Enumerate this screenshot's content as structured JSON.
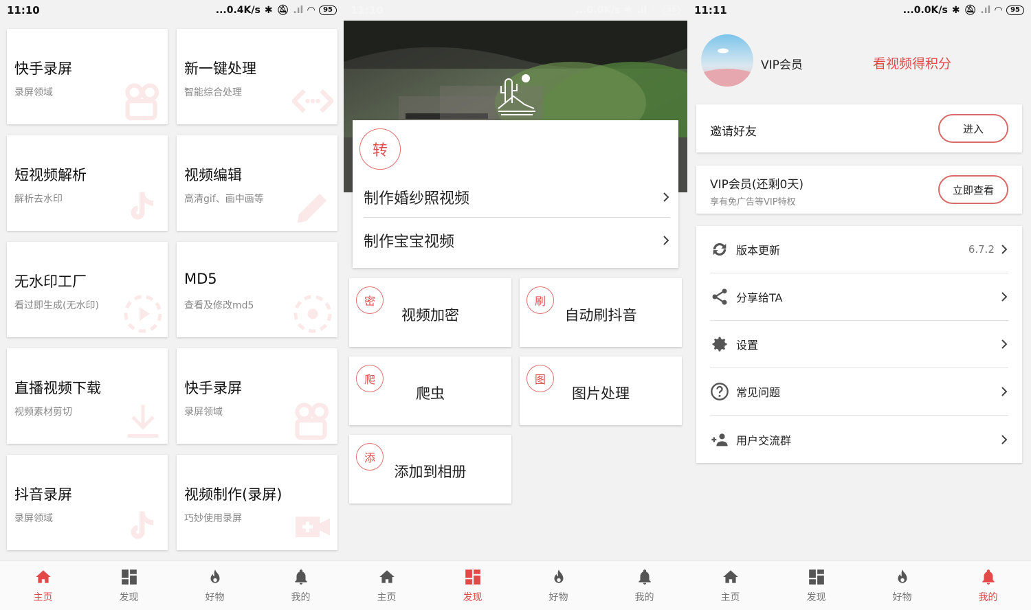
{
  "colors": {
    "accent": "#e24a4a",
    "badge_border": "#e07070"
  },
  "screen1": {
    "status": {
      "time": "11:10",
      "speed": "...0.4K/s",
      "battery": "95"
    },
    "cards": [
      {
        "title": "快手录屏",
        "sub": "录屏领域",
        "icon": "video-camera-icon"
      },
      {
        "title": "新一键处理",
        "sub": "智能综合处理",
        "icon": "code-arrows-icon"
      },
      {
        "title": "短视频解析",
        "sub": "解析去水印",
        "icon": "tiktok-note-icon"
      },
      {
        "title": "视频编辑",
        "sub": "高清gif、画中画等",
        "icon": "pencil-icon"
      },
      {
        "title": "无水印工厂",
        "sub": "看过即生成(无水印)",
        "icon": "play-circle-icon"
      },
      {
        "title": "MD5",
        "sub": "查看及修改md5",
        "icon": "target-icon"
      },
      {
        "title": "直播视频下载",
        "sub": "视频素材剪切",
        "icon": "download-icon"
      },
      {
        "title": "快手录屏",
        "sub": "录屏领域",
        "icon": "video-camera-icon"
      },
      {
        "title": "抖音录屏",
        "sub": "录屏领域",
        "icon": "tiktok-note-icon"
      },
      {
        "title": "视频制作(录屏)",
        "sub": "巧妙使用录屏",
        "icon": "add-video-icon"
      }
    ]
  },
  "screen2": {
    "status": {
      "time": "11:10",
      "speed": "...0.0K/s",
      "battery": "95"
    },
    "feature": {
      "badge": "转",
      "rows": [
        "制作婚纱照视频",
        "制作宝宝视频"
      ]
    },
    "tiles": [
      {
        "badge": "密",
        "label": "视频加密"
      },
      {
        "badge": "刷",
        "label": "自动刷抖音"
      },
      {
        "badge": "爬",
        "label": "爬虫"
      },
      {
        "badge": "图",
        "label": "图片处理"
      },
      {
        "badge": "添",
        "label": "添加到相册"
      }
    ]
  },
  "screen3": {
    "status": {
      "time": "11:11",
      "speed": "...0.0K/s",
      "battery": "95"
    },
    "profile": {
      "name": "VIP会员",
      "points_link": "看视频得积分"
    },
    "invite": {
      "label": "邀请好友",
      "button": "进入"
    },
    "vip": {
      "title": "VIP会员(还剩0天)",
      "sub": "享有免广告等VIP特权",
      "button": "立即查看"
    },
    "menu": [
      {
        "label": "版本更新",
        "value": "6.7.2",
        "icon": "refresh-icon"
      },
      {
        "label": "分享给TA",
        "value": "",
        "icon": "share-icon"
      },
      {
        "label": "设置",
        "value": "",
        "icon": "gear-icon"
      },
      {
        "label": "常见问题",
        "value": "",
        "icon": "question-icon"
      },
      {
        "label": "用户交流群",
        "value": "",
        "icon": "group-icon"
      }
    ]
  },
  "nav": [
    "主页",
    "发现",
    "好物",
    "我的"
  ]
}
